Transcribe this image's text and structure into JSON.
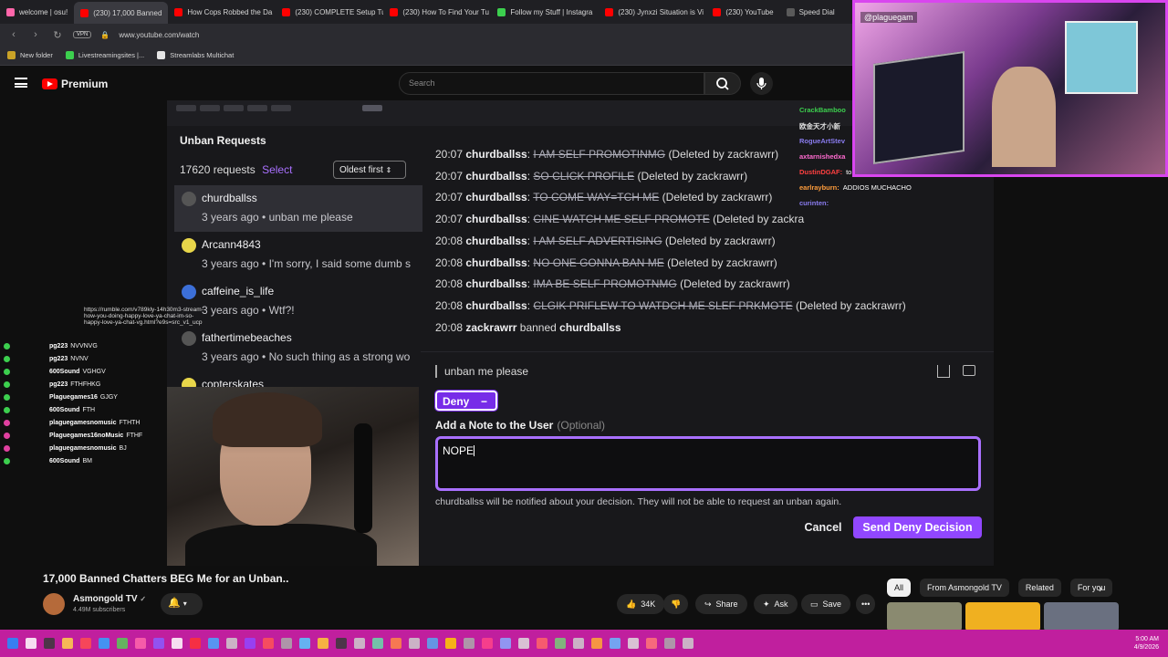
{
  "browser": {
    "tabs": [
      {
        "label": "welcome | osu!",
        "color": "#ff66aa",
        "active": false
      },
      {
        "label": "(230) 17,000 Banned",
        "color": "#ff0000",
        "active": true
      },
      {
        "label": "How Cops Robbed the Da",
        "color": "#ff0000",
        "active": false
      },
      {
        "label": "(230) COMPLETE Setup Tu",
        "color": "#ff0000",
        "active": false
      },
      {
        "label": "(230) How To Find Your Tu",
        "color": "#ff0000",
        "active": false
      },
      {
        "label": "Follow my Stuff | Instagra",
        "color": "#3ccf4e",
        "active": false
      },
      {
        "label": "(230) Jynxzi Situation is Vi",
        "color": "#ff0000",
        "active": false
      },
      {
        "label": "(230) YouTube",
        "color": "#ff0000",
        "active": false
      },
      {
        "label": "Speed Dial",
        "color": "#5a5a5a",
        "active": false
      }
    ],
    "url": "www.youtube.com/watch",
    "vpn_label": "VPN",
    "bookmarks": [
      {
        "label": "New folder",
        "color": "#c9a227"
      },
      {
        "label": "Livestreamingsites |...",
        "color": "#3ccf4e"
      },
      {
        "label": "Streamlabs Multichat",
        "color": "#e5e5e5"
      }
    ]
  },
  "youtube": {
    "brand": "Premium",
    "search_placeholder": "Search"
  },
  "twitch": {
    "panel_title": "Unban Requests",
    "request_count": "17620 requests",
    "select_label": "Select",
    "sort_label": "Oldest first",
    "requests": [
      {
        "user": "churdballss",
        "meta": "3 years ago • unban me please",
        "avatar_color": "#555555",
        "selected": true
      },
      {
        "user": "Arcann4843",
        "meta": "3 years ago • I'm sorry, I said some dumb s",
        "avatar_color": "#e8d64a",
        "selected": false
      },
      {
        "user": "caffeine_is_life",
        "meta": "3 years ago • Wtf?!",
        "avatar_color": "#3c6fd8",
        "selected": false
      },
      {
        "user": "fathertimebeaches",
        "meta": "3 years ago • No such thing as a strong wo",
        "avatar_color": "#555555",
        "selected": false
      },
      {
        "user": "copterskates",
        "meta": "",
        "avatar_color": "#e8d64a",
        "selected": false
      }
    ],
    "chat_log": [
      {
        "time": "20:07",
        "user": "churdballss",
        "msg": "I AM SELF PROMOTINMG",
        "note": "(Deleted by zackrawrr)"
      },
      {
        "time": "20:07",
        "user": "churdballss",
        "msg": "SO CLICK PROFILE",
        "note": "(Deleted by zackrawrr)"
      },
      {
        "time": "20:07",
        "user": "churdballss",
        "msg": "TO COME WAY=TCH ME",
        "note": "(Deleted by zackrawrr)"
      },
      {
        "time": "20:07",
        "user": "churdballss",
        "msg": "CINE WATCH ME SELF PROMOTE",
        "note": "(Deleted by zackra"
      },
      {
        "time": "20:08",
        "user": "churdballss",
        "msg": "I AM SELF ADVERTISING",
        "note": "(Deleted by zackrawrr)"
      },
      {
        "time": "20:08",
        "user": "churdballss",
        "msg": "NO ONE GONNA BAN ME",
        "note": "(Deleted by zackrawrr)"
      },
      {
        "time": "20:08",
        "user": "churdballss",
        "msg": "IMA BE SELF PROMOTNMG",
        "note": "(Deleted by zackrawrr)"
      },
      {
        "time": "20:08",
        "user": "churdballss",
        "msg": "CLGIK PRIFLEW TO WATDCH ME SLEF PRKMOTE",
        "note": "(Deleted by zackrawrr)"
      }
    ],
    "ban_line": {
      "time": "20:08",
      "actor": "zackrawrr",
      "action": "banned",
      "target": "churdballss"
    },
    "request_message": "unban me please",
    "deny_label": "Deny",
    "deny_minus": "−",
    "note_label": "Add a Note to the User",
    "note_optional": "(Optional)",
    "note_value": "NOPE",
    "notify_text": "churdballss will be notified about your decision. They will not be able to request an unban again.",
    "cancel_label": "Cancel",
    "send_label": "Send Deny Decision"
  },
  "overlays": {
    "rumble_link": "https://rumble.com/v789kly-14h30m3-stream-how-you-doing-happy-love-ya-chat-im-so-happy-love-ya-chat-vg.html?e9s=src_v1_ucp",
    "left_chat": [
      {
        "name": "pg223",
        "msg": "NVVNVG",
        "color": "#3ccf4e"
      },
      {
        "name": "pg223",
        "msg": "NVNV",
        "color": "#3ccf4e"
      },
      {
        "name": "600Sound",
        "msg": "VGHGV",
        "color": "#3ccf4e"
      },
      {
        "name": "pg223",
        "msg": "FTHFHKG",
        "color": "#3ccf4e"
      },
      {
        "name": "Plaguegames16",
        "msg": "GJGY",
        "color": "#3ccf4e"
      },
      {
        "name": "600Sound",
        "msg": "FTH",
        "color": "#3ccf4e"
      },
      {
        "name": "plaguegamesnomusic",
        "msg": "FTHTH",
        "color": "#e040a0"
      },
      {
        "name": "Plaguegames16noMusic",
        "msg": "FTHF",
        "color": "#e040a0"
      },
      {
        "name": "plaguegamesnomusic",
        "msg": "BJ",
        "color": "#e040a0"
      },
      {
        "name": "600Sound",
        "msg": "BM",
        "color": "#3ccf4e"
      }
    ],
    "right_chat": [
      {
        "name": "CrackBamboo",
        "msg": "",
        "color": "#3ccf4e"
      },
      {
        "name": "欧金天才小新",
        "msg": "",
        "color": "#e0e0e0"
      },
      {
        "name": "RogueArtStev",
        "msg": "",
        "color": "#8a7cf0"
      },
      {
        "name": "axtarnishedxa",
        "msg": "",
        "color": "#ff6bd0"
      },
      {
        "name": "DustinDGAF:",
        "msg": "to we go to do an unban request",
        "color": "#ff4040"
      },
      {
        "name": "earlrayburn:",
        "msg": "ADDIOS MUCHACHO",
        "color": "#ff9d3c"
      },
      {
        "name": "curinten:",
        "msg": "",
        "color": "#8a7cf0"
      }
    ],
    "cam_handle": "@plaguegam"
  },
  "video": {
    "title": "17,000 Banned Chatters BEG Me for an Unban..",
    "channel": "Asmongold TV",
    "verified": "✓",
    "subscribers": "4.49M subscribers",
    "likes": "34K",
    "share_label": "Share",
    "ask_label": "Ask",
    "save_label": "Save",
    "more": "•••"
  },
  "recommendations": {
    "chips": [
      "All",
      "From Asmongold TV",
      "Related",
      "For you"
    ],
    "thumb_colors": [
      "#8a8a70",
      "#f0b020",
      "#6a7080"
    ]
  },
  "taskbar": {
    "time": "5:00 AM",
    "date": "4/9/2026"
  }
}
